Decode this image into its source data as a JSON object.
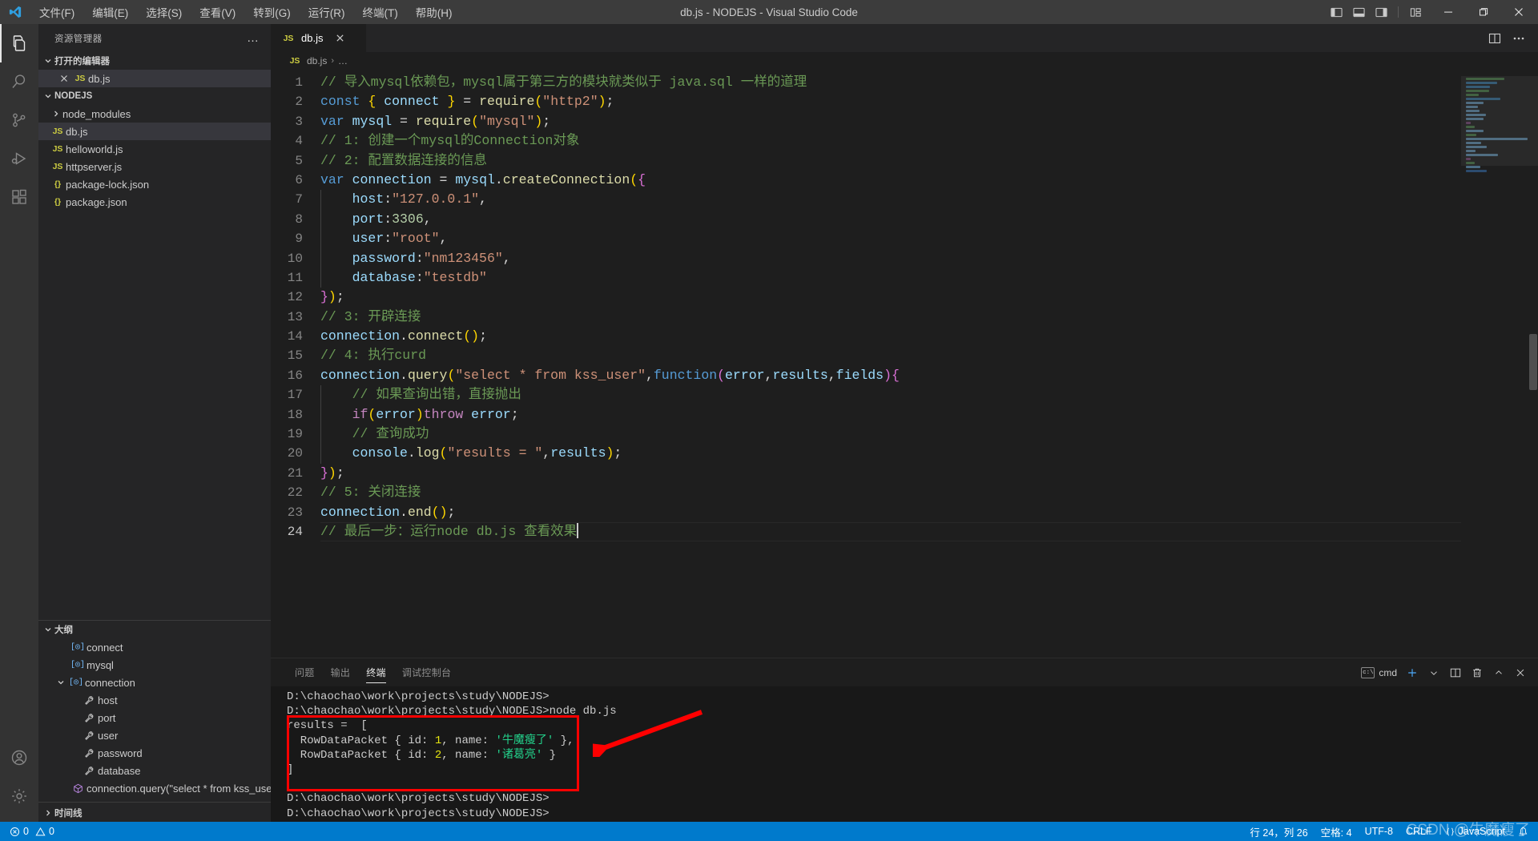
{
  "titlebar": {
    "title": "db.js - NODEJS - Visual Studio Code",
    "menus": [
      {
        "label": "文件(F)",
        "name": "menu-file"
      },
      {
        "label": "编辑(E)",
        "name": "menu-edit"
      },
      {
        "label": "选择(S)",
        "name": "menu-selection"
      },
      {
        "label": "查看(V)",
        "name": "menu-view"
      },
      {
        "label": "转到(G)",
        "name": "menu-go"
      },
      {
        "label": "运行(R)",
        "name": "menu-run"
      },
      {
        "label": "终端(T)",
        "name": "menu-terminal"
      },
      {
        "label": "帮助(H)",
        "name": "menu-help"
      }
    ],
    "layout_icons": [
      "toggle-primary-sidebar-icon",
      "toggle-panel-icon",
      "toggle-secondary-sidebar-icon",
      "customize-layout-icon"
    ],
    "window_controls": [
      "minimize-icon",
      "maximize-icon",
      "close-icon"
    ]
  },
  "activitybar": {
    "items": [
      {
        "name": "activity-explorer",
        "icon": "files-icon",
        "active": true
      },
      {
        "name": "activity-search",
        "icon": "search-icon",
        "active": false
      },
      {
        "name": "activity-source-control",
        "icon": "source-control-icon",
        "active": false
      },
      {
        "name": "activity-run-debug",
        "icon": "run-and-debug-icon",
        "active": false
      },
      {
        "name": "activity-extensions",
        "icon": "extensions-icon",
        "active": false
      }
    ],
    "bottom": [
      {
        "name": "activity-accounts",
        "icon": "account-icon"
      },
      {
        "name": "activity-settings",
        "icon": "gear-icon"
      }
    ]
  },
  "sidebar": {
    "title": "资源管理器",
    "more_label": "…",
    "open_editors": {
      "label": "打开的编辑器",
      "items": [
        {
          "name": "db.js",
          "icon": "js-icon",
          "selected": true,
          "close": "×"
        }
      ]
    },
    "folder": {
      "label": "NODEJS",
      "items": [
        {
          "name": "node_modules",
          "icon": "chevron-right-icon",
          "kind": "folder",
          "indent": 1,
          "selected": false
        },
        {
          "name": "db.js",
          "icon": "js-icon",
          "kind": "js",
          "indent": 1,
          "selected": true
        },
        {
          "name": "helloworld.js",
          "icon": "js-icon",
          "kind": "js",
          "indent": 1,
          "selected": false
        },
        {
          "name": "httpserver.js",
          "icon": "js-icon",
          "kind": "js",
          "indent": 1,
          "selected": false
        },
        {
          "name": "package-lock.json",
          "icon": "json-icon",
          "kind": "json",
          "indent": 1,
          "selected": false
        },
        {
          "name": "package.json",
          "icon": "json-icon",
          "kind": "json",
          "indent": 1,
          "selected": false
        }
      ]
    },
    "outline": {
      "label": "大纲",
      "items": [
        {
          "name": "connect",
          "sym": "variable",
          "indent": 2,
          "twisty": false
        },
        {
          "name": "mysql",
          "sym": "variable",
          "indent": 2,
          "twisty": false
        },
        {
          "name": "connection",
          "sym": "variable",
          "indent": 1,
          "twisty": true
        },
        {
          "name": "host",
          "sym": "property",
          "indent": 3,
          "twisty": false
        },
        {
          "name": "port",
          "sym": "property",
          "indent": 3,
          "twisty": false
        },
        {
          "name": "user",
          "sym": "property",
          "indent": 3,
          "twisty": false
        },
        {
          "name": "password",
          "sym": "property",
          "indent": 3,
          "twisty": false
        },
        {
          "name": "database",
          "sym": "property",
          "indent": 3,
          "twisty": false
        },
        {
          "name": "connection.query(\"select * from kss_user\")…",
          "sym": "object",
          "indent": 2,
          "twisty": false
        }
      ]
    },
    "timeline": {
      "label": "时间线"
    }
  },
  "editor": {
    "tab": {
      "label": "db.js",
      "icon": "js-icon",
      "close": "×"
    },
    "actions": [
      "split-editor-icon",
      "more-actions-icon"
    ],
    "breadcrumb": {
      "file": "db.js",
      "sep": "›",
      "rest": "…"
    },
    "cursor_line": 24,
    "lines": [
      {
        "n": 1,
        "tokens": [
          {
            "t": "// 导入mysql依赖包，mysql属于第三方的模块就类似于 java.sql 一样的道理",
            "c": "c-com"
          }
        ]
      },
      {
        "n": 2,
        "tokens": [
          {
            "t": "const",
            "c": "c-kw"
          },
          {
            "t": " ",
            "c": "c-pun"
          },
          {
            "t": "{",
            "c": "c-br1"
          },
          {
            "t": " connect ",
            "c": "c-var"
          },
          {
            "t": "}",
            "c": "c-br1"
          },
          {
            "t": " = ",
            "c": "c-pun"
          },
          {
            "t": "require",
            "c": "c-fn"
          },
          {
            "t": "(",
            "c": "c-br1"
          },
          {
            "t": "\"http2\"",
            "c": "c-str"
          },
          {
            "t": ")",
            "c": "c-br1"
          },
          {
            "t": ";",
            "c": "c-pun"
          }
        ]
      },
      {
        "n": 3,
        "tokens": [
          {
            "t": "var",
            "c": "c-kw"
          },
          {
            "t": " ",
            "c": "c-pun"
          },
          {
            "t": "mysql",
            "c": "c-var"
          },
          {
            "t": " = ",
            "c": "c-pun"
          },
          {
            "t": "require",
            "c": "c-fn"
          },
          {
            "t": "(",
            "c": "c-br1"
          },
          {
            "t": "\"mysql\"",
            "c": "c-str"
          },
          {
            "t": ")",
            "c": "c-br1"
          },
          {
            "t": ";",
            "c": "c-pun"
          }
        ]
      },
      {
        "n": 4,
        "tokens": [
          {
            "t": "// 1: 创建一个mysql的Connection对象",
            "c": "c-com"
          }
        ]
      },
      {
        "n": 5,
        "tokens": [
          {
            "t": "// 2: 配置数据连接的信息",
            "c": "c-com"
          }
        ]
      },
      {
        "n": 6,
        "tokens": [
          {
            "t": "var",
            "c": "c-kw"
          },
          {
            "t": " ",
            "c": "c-pun"
          },
          {
            "t": "connection",
            "c": "c-var"
          },
          {
            "t": " = ",
            "c": "c-pun"
          },
          {
            "t": "mysql",
            "c": "c-var"
          },
          {
            "t": ".",
            "c": "c-pun"
          },
          {
            "t": "createConnection",
            "c": "c-fn"
          },
          {
            "t": "(",
            "c": "c-br1"
          },
          {
            "t": "{",
            "c": "c-br2"
          }
        ]
      },
      {
        "n": 7,
        "indent": 1,
        "tokens": [
          {
            "t": "    ",
            "c": "c-pun"
          },
          {
            "t": "host",
            "c": "c-var"
          },
          {
            "t": ":",
            "c": "c-pun"
          },
          {
            "t": "\"127.0.0.1\"",
            "c": "c-str"
          },
          {
            "t": ",",
            "c": "c-pun"
          }
        ]
      },
      {
        "n": 8,
        "indent": 1,
        "tokens": [
          {
            "t": "    ",
            "c": "c-pun"
          },
          {
            "t": "port",
            "c": "c-var"
          },
          {
            "t": ":",
            "c": "c-pun"
          },
          {
            "t": "3306",
            "c": "c-num"
          },
          {
            "t": ",",
            "c": "c-pun"
          }
        ]
      },
      {
        "n": 9,
        "indent": 1,
        "tokens": [
          {
            "t": "    ",
            "c": "c-pun"
          },
          {
            "t": "user",
            "c": "c-var"
          },
          {
            "t": ":",
            "c": "c-pun"
          },
          {
            "t": "\"root\"",
            "c": "c-str"
          },
          {
            "t": ",",
            "c": "c-pun"
          }
        ]
      },
      {
        "n": 10,
        "indent": 1,
        "tokens": [
          {
            "t": "    ",
            "c": "c-pun"
          },
          {
            "t": "password",
            "c": "c-var"
          },
          {
            "t": ":",
            "c": "c-pun"
          },
          {
            "t": "\"nm123456\"",
            "c": "c-str"
          },
          {
            "t": ",",
            "c": "c-pun"
          }
        ]
      },
      {
        "n": 11,
        "indent": 1,
        "tokens": [
          {
            "t": "    ",
            "c": "c-pun"
          },
          {
            "t": "database",
            "c": "c-var"
          },
          {
            "t": ":",
            "c": "c-pun"
          },
          {
            "t": "\"testdb\"",
            "c": "c-str"
          }
        ]
      },
      {
        "n": 12,
        "tokens": [
          {
            "t": "}",
            "c": "c-br2"
          },
          {
            "t": ")",
            "c": "c-br1"
          },
          {
            "t": ";",
            "c": "c-pun"
          }
        ]
      },
      {
        "n": 13,
        "tokens": [
          {
            "t": "// 3: 开辟连接",
            "c": "c-com"
          }
        ]
      },
      {
        "n": 14,
        "tokens": [
          {
            "t": "connection",
            "c": "c-var"
          },
          {
            "t": ".",
            "c": "c-pun"
          },
          {
            "t": "connect",
            "c": "c-fn"
          },
          {
            "t": "(",
            "c": "c-br1"
          },
          {
            "t": ")",
            "c": "c-br1"
          },
          {
            "t": ";",
            "c": "c-pun"
          }
        ]
      },
      {
        "n": 15,
        "tokens": [
          {
            "t": "// 4: 执行curd",
            "c": "c-com"
          }
        ]
      },
      {
        "n": 16,
        "tokens": [
          {
            "t": "connection",
            "c": "c-var"
          },
          {
            "t": ".",
            "c": "c-pun"
          },
          {
            "t": "query",
            "c": "c-fn"
          },
          {
            "t": "(",
            "c": "c-br1"
          },
          {
            "t": "\"select * from kss_user\"",
            "c": "c-str"
          },
          {
            "t": ",",
            "c": "c-pun"
          },
          {
            "t": "function",
            "c": "c-kw"
          },
          {
            "t": "(",
            "c": "c-br2"
          },
          {
            "t": "error",
            "c": "c-var"
          },
          {
            "t": ",",
            "c": "c-pun"
          },
          {
            "t": "results",
            "c": "c-var"
          },
          {
            "t": ",",
            "c": "c-pun"
          },
          {
            "t": "fields",
            "c": "c-var"
          },
          {
            "t": ")",
            "c": "c-br2"
          },
          {
            "t": "{",
            "c": "c-br2"
          }
        ]
      },
      {
        "n": 17,
        "indent": 1,
        "tokens": [
          {
            "t": "    ",
            "c": "c-pun"
          },
          {
            "t": "// 如果查询出错，直接抛出",
            "c": "c-com"
          }
        ]
      },
      {
        "n": 18,
        "indent": 1,
        "tokens": [
          {
            "t": "    ",
            "c": "c-pun"
          },
          {
            "t": "if",
            "c": "c-kw2"
          },
          {
            "t": "(",
            "c": "c-br1"
          },
          {
            "t": "error",
            "c": "c-var"
          },
          {
            "t": ")",
            "c": "c-br1"
          },
          {
            "t": "throw",
            "c": "c-kw2"
          },
          {
            "t": " ",
            "c": "c-pun"
          },
          {
            "t": "error",
            "c": "c-var"
          },
          {
            "t": ";",
            "c": "c-pun"
          }
        ]
      },
      {
        "n": 19,
        "indent": 1,
        "tokens": [
          {
            "t": "    ",
            "c": "c-pun"
          },
          {
            "t": "// 查询成功",
            "c": "c-com"
          }
        ]
      },
      {
        "n": 20,
        "indent": 1,
        "tokens": [
          {
            "t": "    ",
            "c": "c-pun"
          },
          {
            "t": "console",
            "c": "c-var"
          },
          {
            "t": ".",
            "c": "c-pun"
          },
          {
            "t": "log",
            "c": "c-fn"
          },
          {
            "t": "(",
            "c": "c-br1"
          },
          {
            "t": "\"results = \"",
            "c": "c-str"
          },
          {
            "t": ",",
            "c": "c-pun"
          },
          {
            "t": "results",
            "c": "c-var"
          },
          {
            "t": ")",
            "c": "c-br1"
          },
          {
            "t": ";",
            "c": "c-pun"
          }
        ]
      },
      {
        "n": 21,
        "tokens": [
          {
            "t": "}",
            "c": "c-br2"
          },
          {
            "t": ")",
            "c": "c-br1"
          },
          {
            "t": ";",
            "c": "c-pun"
          }
        ]
      },
      {
        "n": 22,
        "tokens": [
          {
            "t": "// 5: 关闭连接",
            "c": "c-com"
          }
        ]
      },
      {
        "n": 23,
        "tokens": [
          {
            "t": "connection",
            "c": "c-var"
          },
          {
            "t": ".",
            "c": "c-pun"
          },
          {
            "t": "end",
            "c": "c-fn"
          },
          {
            "t": "(",
            "c": "c-br1"
          },
          {
            "t": ")",
            "c": "c-br1"
          },
          {
            "t": ";",
            "c": "c-pun"
          }
        ]
      },
      {
        "n": 24,
        "tokens": [
          {
            "t": "// 最后一步：运行node db.js 查看效果",
            "c": "c-com"
          }
        ],
        "cursor": true
      }
    ]
  },
  "panel": {
    "tabs": [
      {
        "label": "问题",
        "name": "panel-tab-problems",
        "active": false
      },
      {
        "label": "输出",
        "name": "panel-tab-output",
        "active": false
      },
      {
        "label": "终端",
        "name": "panel-tab-terminal",
        "active": true
      },
      {
        "label": "调试控制台",
        "name": "panel-tab-debug-console",
        "active": false
      }
    ],
    "terminal_shell": "cmd",
    "shell_icon_text": "c:\\",
    "actions": [
      "new-terminal-icon",
      "chevron-down-icon",
      "split-terminal-icon",
      "kill-terminal-icon",
      "maximize-panel-icon",
      "close-panel-icon"
    ],
    "terminal_lines": [
      [
        {
          "t": "D:\\chaochao\\work\\projects\\study\\NODEJS>",
          "c": ""
        }
      ],
      [
        {
          "t": "D:\\chaochao\\work\\projects\\study\\NODEJS>node db.js",
          "c": ""
        }
      ],
      [
        {
          "t": "results =  [",
          "c": ""
        }
      ],
      [
        {
          "t": "  RowDataPacket { id: ",
          "c": ""
        },
        {
          "t": "1",
          "c": "t-yellow"
        },
        {
          "t": ", name: ",
          "c": ""
        },
        {
          "t": "'牛魔瘦了'",
          "c": "t-green"
        },
        {
          "t": " },",
          "c": ""
        }
      ],
      [
        {
          "t": "  RowDataPacket { id: ",
          "c": ""
        },
        {
          "t": "2",
          "c": "t-yellow"
        },
        {
          "t": ", name: ",
          "c": ""
        },
        {
          "t": "'诸葛亮'",
          "c": "t-green"
        },
        {
          "t": " }",
          "c": ""
        }
      ],
      [
        {
          "t": "]",
          "c": ""
        }
      ],
      [
        {
          "t": "",
          "c": ""
        }
      ],
      [
        {
          "t": "D:\\chaochao\\work\\projects\\study\\NODEJS>",
          "c": ""
        }
      ],
      [
        {
          "t": "D:\\chaochao\\work\\projects\\study\\NODEJS>",
          "c": ""
        }
      ]
    ],
    "annotation": {
      "box_color": "#ff0000",
      "arrow_color": "#ff0000"
    }
  },
  "statusbar": {
    "errors": "0",
    "warnings": "0",
    "position": "行 24，列 26",
    "spaces": "空格: 4",
    "encoding": "UTF-8",
    "eol": "CRLF",
    "language": "JavaScript",
    "bell": "notifications-bell-icon",
    "accent": "#007acc",
    "watermark": "CSDN @牛魔瘦了"
  }
}
